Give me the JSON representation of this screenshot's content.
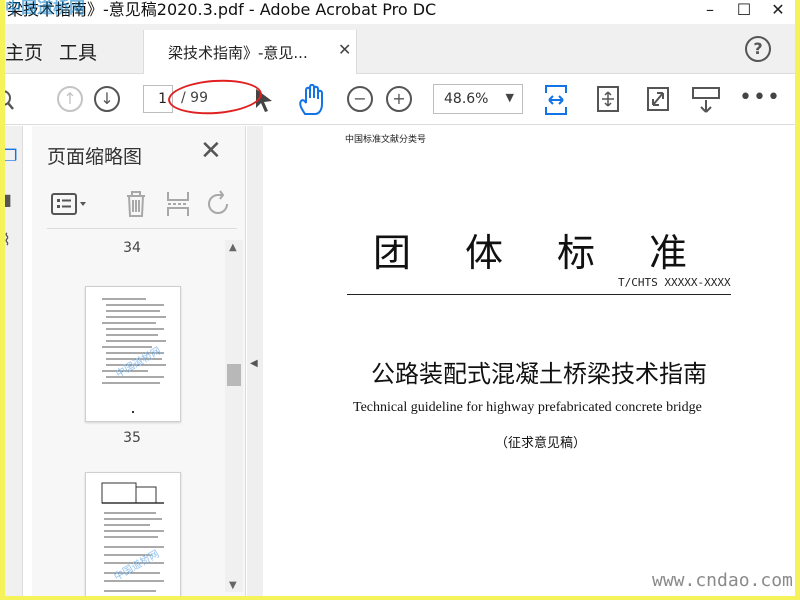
{
  "window": {
    "title": "梁技术指南》-意见稿2020.3.pdf - Adobe Acrobat Pro DC",
    "watermark_overlay": "中国道桥网"
  },
  "tabs": {
    "home": "主页",
    "tools": "工具",
    "document": "梁技术指南》-意见..."
  },
  "toolbar": {
    "current_page": "1",
    "total_pages": "/ 99",
    "zoom": "48.6%"
  },
  "thumbnails": {
    "panel_title": "页面缩略图",
    "pages": [
      {
        "label": "34"
      },
      {
        "label": "35"
      }
    ]
  },
  "document": {
    "class_no": "中国标准文献分类号",
    "title": "团体标准",
    "code": "T/CHTS XXXXX-XXXX",
    "cn_title": "公路装配式混凝土桥梁技术指南",
    "en_title": "Technical guideline for highway prefabricated concrete bridge",
    "draft_note": "（征求意见稿）"
  },
  "site_watermark": "www.cndao.com",
  "colors": {
    "outer_border": "#f6f35a",
    "highlight_ellipse": "#e02020",
    "accent_blue": "#1473e6"
  }
}
